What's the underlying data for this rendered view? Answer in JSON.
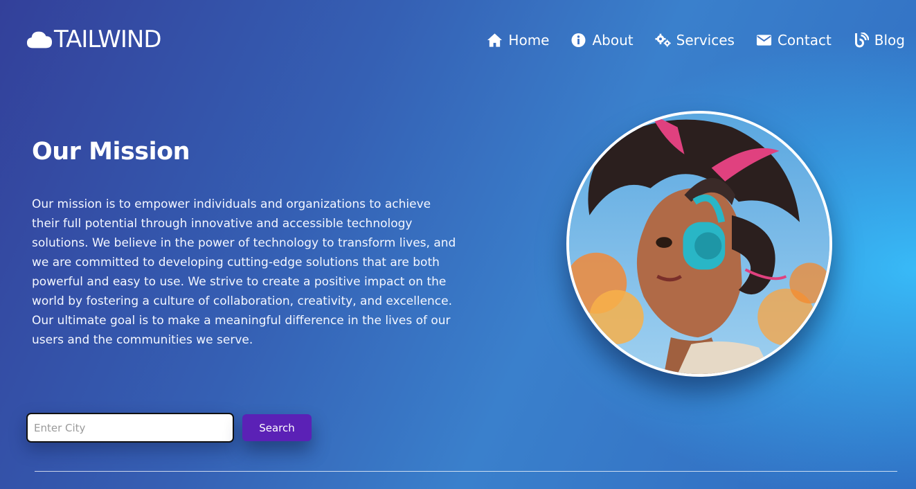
{
  "brand": {
    "name": "TAILWIND",
    "icon": "cloud-icon"
  },
  "nav": {
    "items": [
      {
        "label": "Home",
        "icon": "home-icon"
      },
      {
        "label": "About",
        "icon": "info-icon"
      },
      {
        "label": "Services",
        "icon": "gears-icon"
      },
      {
        "label": "Contact",
        "icon": "envelope-icon"
      },
      {
        "label": "Blog",
        "icon": "blog-icon"
      }
    ]
  },
  "mission": {
    "title": "Our Mission",
    "body": "Our mission is to empower individuals and organizations to achieve their full potential through innovative and accessible technology solutions. We believe in the power of technology to transform lives, and we are committed to developing cutting-edge solutions that are both powerful and easy to use. We strive to create a positive impact on the world by fostering a culture of collaboration, creativity, and excellence. Our ultimate goal is to make a meaningful difference in the lives of our users and the communities we serve."
  },
  "search": {
    "placeholder": "Enter City",
    "value": "",
    "button_label": "Search"
  },
  "colors": {
    "accent": "#5b21b6",
    "gradient_start": "#33409a",
    "gradient_end": "#38bef9"
  }
}
